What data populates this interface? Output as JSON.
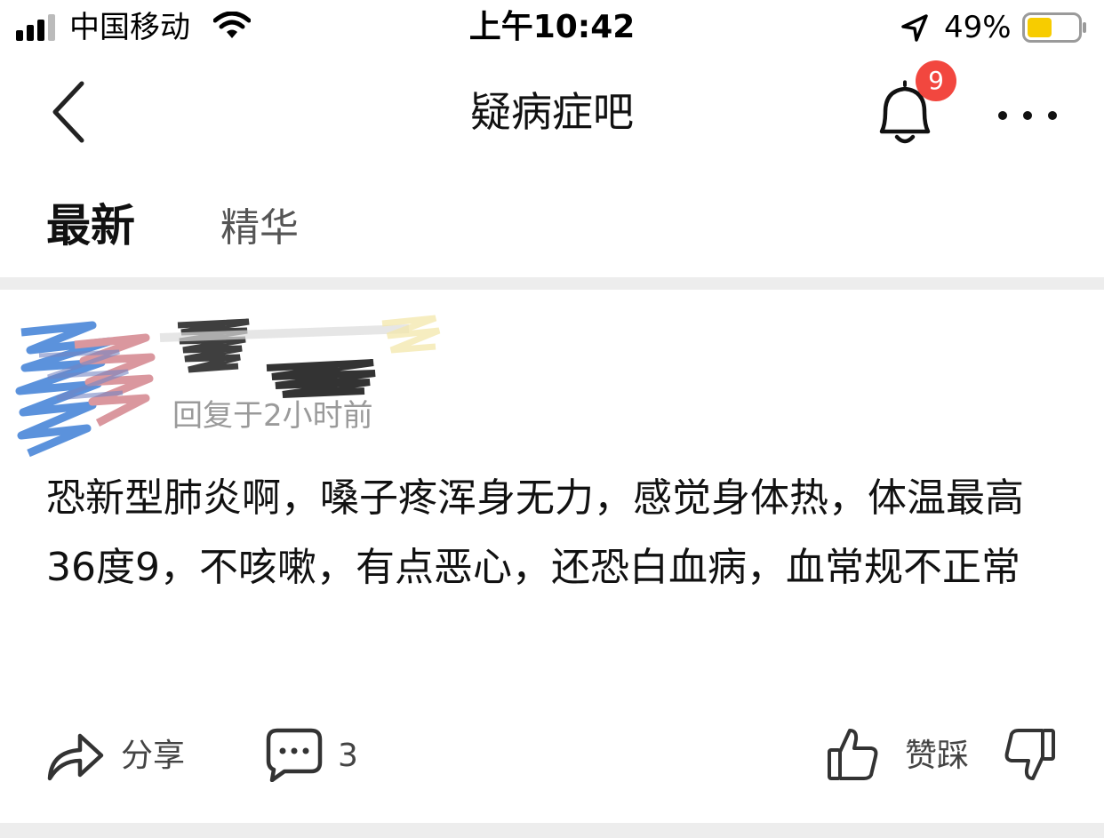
{
  "status_bar": {
    "carrier": "中国移动",
    "time": "上午10:42",
    "battery_percent": "49%",
    "battery_level": 0.49,
    "icons": [
      "signal-icon",
      "wifi-icon",
      "location-arrow-icon",
      "battery-icon"
    ]
  },
  "nav": {
    "title": "疑病症吧",
    "notification_count": "9",
    "icons": [
      "back-chevron-icon",
      "bell-icon",
      "more-icon"
    ]
  },
  "tabs": [
    {
      "label": "最新",
      "active": true
    },
    {
      "label": "精华",
      "active": false
    }
  ],
  "post": {
    "meta": "回复于2小时前",
    "text": "恐新型肺炎啊，嗓子疼浑身无力，感觉身体热，体温最高36度9，不咳嗽，有点恶心，还恐白血病，血常规不正常",
    "actions": {
      "share_label": "分享",
      "comment_count": "3",
      "vote_label": "赞踩"
    },
    "icons": [
      "share-icon",
      "comment-icon",
      "thumbs-up-icon",
      "thumbs-down-icon"
    ]
  },
  "colors": {
    "badge": "#f2473f",
    "battery_fill": "#f7cc00",
    "meta_text": "#9a9a9a",
    "divider": "#ededed"
  }
}
